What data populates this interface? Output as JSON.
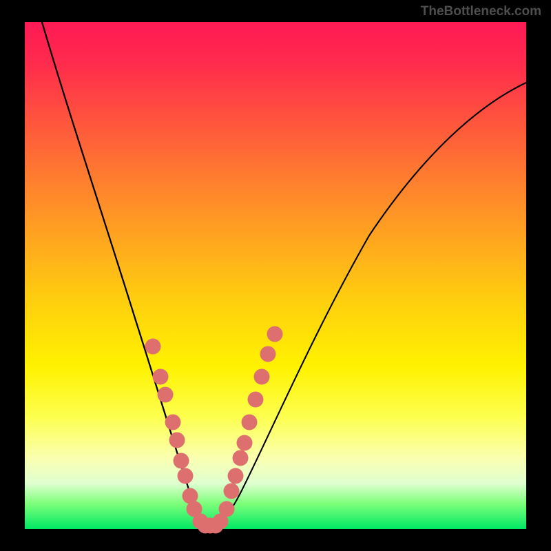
{
  "watermark": "TheBottleneck.com",
  "chart_data": {
    "type": "line",
    "title": "",
    "xlabel": "",
    "ylabel": "",
    "xlim": [
      0,
      100
    ],
    "ylim": [
      0,
      100
    ],
    "series": [
      {
        "name": "left-branch",
        "x": [
          3,
          6,
          10,
          14,
          18,
          22,
          25,
          28,
          30,
          32,
          33.5,
          35,
          36
        ],
        "y": [
          100,
          88,
          74,
          60,
          47,
          35,
          25,
          16,
          10,
          5,
          2,
          0.5,
          0
        ]
      },
      {
        "name": "right-branch",
        "x": [
          36,
          38,
          41,
          45,
          50,
          56,
          63,
          71,
          80,
          90,
          100
        ],
        "y": [
          0,
          2,
          8,
          17,
          28,
          40,
          52,
          63,
          73,
          81,
          88
        ]
      }
    ],
    "markers": {
      "name": "highlighted-points",
      "points": [
        {
          "x": 25.5,
          "y": 36
        },
        {
          "x": 27.0,
          "y": 30
        },
        {
          "x": 28.0,
          "y": 26.5
        },
        {
          "x": 29.5,
          "y": 21
        },
        {
          "x": 30.3,
          "y": 17.5
        },
        {
          "x": 31.2,
          "y": 13.5
        },
        {
          "x": 32.0,
          "y": 10.5
        },
        {
          "x": 33.0,
          "y": 6.5
        },
        {
          "x": 33.8,
          "y": 4
        },
        {
          "x": 35.0,
          "y": 1.5
        },
        {
          "x": 36.0,
          "y": 0.7
        },
        {
          "x": 37.0,
          "y": 0.7
        },
        {
          "x": 38.0,
          "y": 0.7
        },
        {
          "x": 39.0,
          "y": 1.5
        },
        {
          "x": 40.2,
          "y": 4
        },
        {
          "x": 41.2,
          "y": 7.5
        },
        {
          "x": 42.0,
          "y": 10.5
        },
        {
          "x": 43.0,
          "y": 14
        },
        {
          "x": 43.8,
          "y": 17
        },
        {
          "x": 44.8,
          "y": 21
        },
        {
          "x": 46.0,
          "y": 25.5
        },
        {
          "x": 47.2,
          "y": 30
        },
        {
          "x": 48.5,
          "y": 34.5
        },
        {
          "x": 49.8,
          "y": 38.5
        }
      ]
    },
    "gradient_stops": [
      {
        "pos": 0,
        "color": "#ff1a55"
      },
      {
        "pos": 55,
        "color": "#ffcf0e"
      },
      {
        "pos": 100,
        "color": "#00e865"
      }
    ]
  }
}
